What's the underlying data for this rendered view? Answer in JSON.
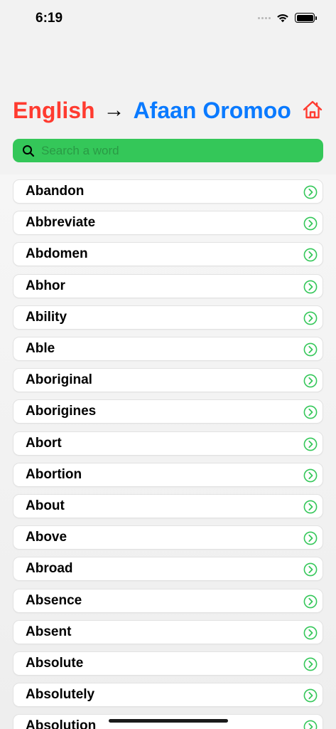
{
  "status": {
    "time": "6:19"
  },
  "header": {
    "from_language": "English",
    "arrow": "→",
    "to_language": "Afaan Oromoo"
  },
  "search": {
    "placeholder": "Search a word",
    "value": ""
  },
  "colors": {
    "from": "#ff3b30",
    "to": "#0a7aff",
    "search_bg": "#34c759",
    "chevron": "#34c759",
    "home": "#ff3b30"
  },
  "words": [
    "Abandon",
    "Abbreviate",
    "Abdomen",
    "Abhor",
    "Ability",
    "Able",
    "Aboriginal",
    "Aborigines",
    "Abort",
    "Abortion",
    "About",
    "Above",
    "Abroad",
    "Absence",
    "Absent",
    "Absolute",
    "Absolutely",
    "Absolution"
  ]
}
